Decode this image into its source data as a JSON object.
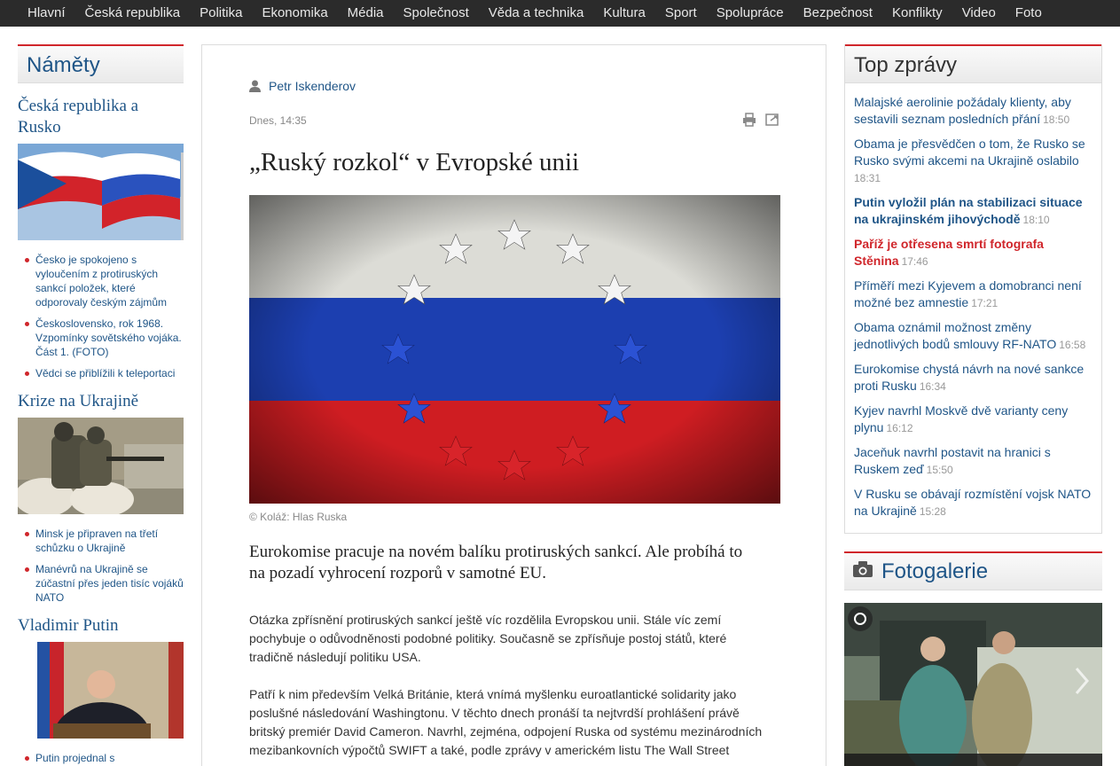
{
  "nav": {
    "items": [
      "Hlavní",
      "Česká republika",
      "Politika",
      "Ekonomika",
      "Média",
      "Společnost",
      "Věda a technika",
      "Kultura",
      "Sport",
      "Spolupráce",
      "Bezpečnost",
      "Konflikty",
      "Video",
      "Foto"
    ]
  },
  "left": {
    "header": "Náměty",
    "topics": [
      {
        "title": "Česká republika a Rusko",
        "links": [
          "Česko je spokojeno s vyloučením z protiruských sankcí položek, které odporovaly českým zájmům",
          "Československo, rok 1968. Vzpomínky sovětského vojáka. Část 1. (FOTO)",
          "Vědci se přiblížili k teleportaci"
        ]
      },
      {
        "title": "Krize na Ukrajině",
        "links": [
          "Minsk je připraven na třetí schůzku o Ukrajině",
          "Manévrů na Ukrajině se zúčastní přes jeden tisíc vojáků NATO"
        ]
      },
      {
        "title": "Vladimir Putin",
        "links": [
          "Putin projednal s Paraguayskym kralu kontrolu",
          ""
        ]
      }
    ]
  },
  "article": {
    "author": "Petr Iskenderov",
    "date": "Dnes, 14:35",
    "title": "„Ruský rozkol“ v Evropské unii",
    "caption": "© Koláž: Hlas Ruska",
    "lead": "Eurokomise pracuje na novém balíku protiruských sankcí. Ale probíhá to na pozadí vyhrocení rozporů v samotné EU.",
    "paragraphs": [
      "Otázka zpřísnění protiruských sankcí ještě víc rozdělila Evropskou unii. Stále víc zemí pochybuje o odůvodněnosti podobné politiky. Současně se zpřísňuje postoj států, které tradičně následují politiku USA.",
      "Patří k nim především Velká Británie, která vnímá myšlenku euroatlantické solidarity jako poslušné následování Washingtonu. V těchto dnech pronáší ta nejtvrdší prohlášení právě britský premiér David Cameron. Navrhl, zejména, odpojení Ruska od systému mezinárodních mezibankovních výpočtů SWIFT a také, podle zprávy v americkém listu The Wall Street"
    ]
  },
  "right": {
    "header": "Top zprávy",
    "news": [
      {
        "text": "Malajské aerolinie požádaly klienty, aby sestavili seznam posledních přání",
        "time": "18:50",
        "style": "normal"
      },
      {
        "text": "Obama je přesvědčen o tom, že Rusko se Rusko svými akcemi na Ukrajině oslabilo",
        "time": "18:31",
        "style": "normal"
      },
      {
        "text": "Putin vyložil plán na stabilizaci situace na ukrajinském jihovýchodě",
        "time": "18:10",
        "style": "bold"
      },
      {
        "text": "Paříž je otřesena smrtí fotografa Stěnina",
        "time": "17:46",
        "style": "red"
      },
      {
        "text": "Příměří mezi Kyjevem a domobranci není možné bez amnestie",
        "time": "17:21",
        "style": "normal"
      },
      {
        "text": "Obama oznámil možnost změny jednotlivých bodů smlouvy RF-NATO",
        "time": "16:58",
        "style": "normal"
      },
      {
        "text": "Eurokomise chystá návrh na nové sankce proti Rusku",
        "time": "16:34",
        "style": "normal"
      },
      {
        "text": "Kyjev navrhl Moskvě dvě varianty ceny plynu",
        "time": "16:12",
        "style": "normal"
      },
      {
        "text": "Jaceňuk navrhl postavit na hranici s Ruskem zeď",
        "time": "15:50",
        "style": "normal"
      },
      {
        "text": "V Rusku se obávají rozmístění vojsk NATO na Ukrajině",
        "time": "15:28",
        "style": "normal"
      }
    ],
    "gallery_header": "Fotogalerie"
  },
  "icons": {
    "author": "person-icon",
    "print": "print-icon",
    "share": "share-icon",
    "camera": "camera-icon",
    "next": "chevron-right-icon"
  },
  "colors": {
    "accent_red": "#d0262b",
    "link_blue": "#1f5587",
    "nav_bg": "#2b2b2b"
  }
}
